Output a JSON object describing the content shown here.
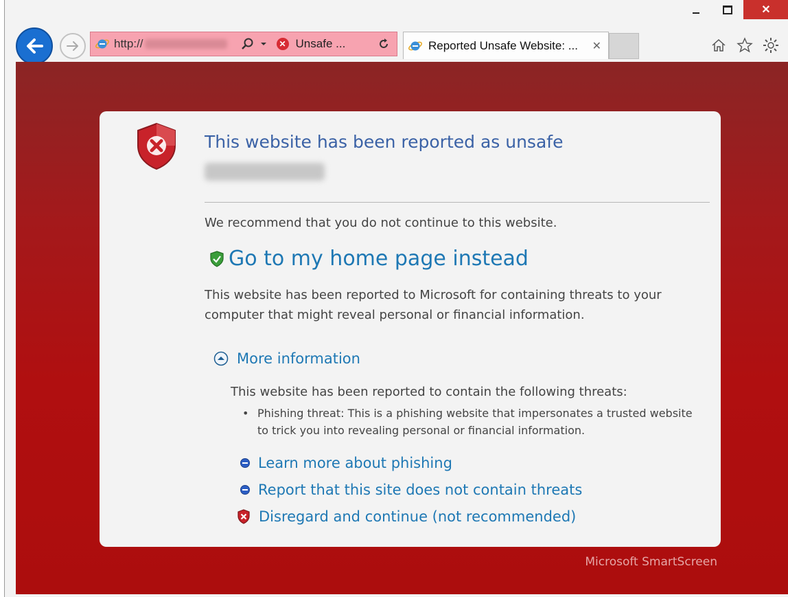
{
  "window": {
    "minimize_icon": "minimize-icon",
    "maximize_icon": "maximize-icon",
    "close_glyph": "✕"
  },
  "nav": {
    "back_icon": "back-arrow-icon",
    "forward_icon": "forward-arrow-icon"
  },
  "address_bar": {
    "url_prefix": "http://",
    "unsafe_label": "Unsafe ...",
    "background_color": "#f7a3b0"
  },
  "tab": {
    "title": "Reported Unsafe Website: ...",
    "close_glyph": "✕"
  },
  "toolbar": {
    "home_icon": "home-icon",
    "favorites_icon": "star-icon",
    "settings_icon": "gear-icon"
  },
  "page": {
    "title": "This website has been reported as unsafe",
    "recommendation": "We recommend that you do not continue to this website.",
    "home_link": "Go to my home page instead",
    "description": "This website has been reported to Microsoft for containing threats to your computer that might reveal personal or financial information.",
    "more_info_label": "More information",
    "threat_heading": "This website has been reported to contain the following threats:",
    "threat_bullet": "•",
    "threat_item": "Phishing threat: This is a phishing website that impersonates a trusted website to trick you into revealing personal or financial information.",
    "actions": {
      "learn_more": "Learn more about phishing",
      "report": "Report that this site does not contain threats",
      "disregard": "Disregard and continue (not recommended)"
    },
    "footer_brand": "Microsoft SmartScreen",
    "colors": {
      "link": "#1e78b4",
      "title": "#3b62a6",
      "background_red": "#b00f10"
    }
  }
}
